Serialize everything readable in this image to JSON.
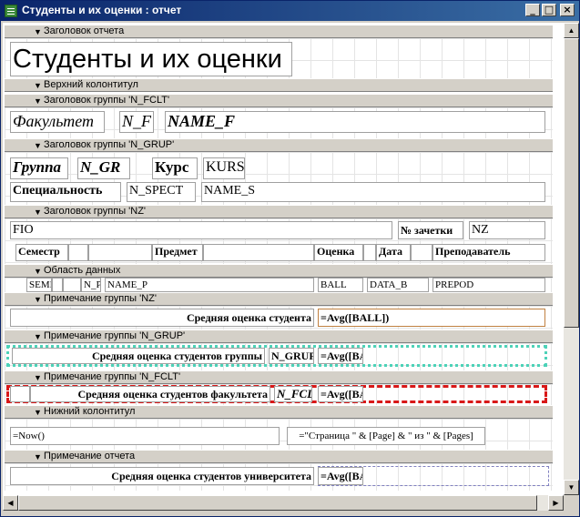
{
  "window": {
    "title": "Студенты и их оценки : отчет",
    "minimize": "_",
    "maximize": "□",
    "close": "×"
  },
  "bars": {
    "report_header": "Заголовок отчета",
    "page_header": "Верхний колонтитул",
    "group_fclt_header": "Заголовок группы 'N_FCLT'",
    "group_grup_header": "Заголовок группы 'N_GRUP'",
    "group_nz_header": "Заголовок группы 'NZ'",
    "detail": "Область данных",
    "group_nz_footer": "Примечание группы 'NZ'",
    "group_grup_footer": "Примечание группы 'N_GRUP'",
    "group_fclt_footer": "Примечание группы 'N_FCLT'",
    "page_footer": "Нижний колонтитул",
    "report_footer": "Примечание отчета"
  },
  "report_header": {
    "title": "Студенты и их оценки"
  },
  "fclt": {
    "label": "Факультет",
    "n_f": "N_F",
    "name_f": "NAME_F"
  },
  "grup": {
    "label": "Группа",
    "n_gr": "N_GR",
    "kurs_label": "Курс",
    "kurs": "KURS",
    "spec_label": "Специальность",
    "n_spect": "N_SPECT",
    "name_s": "NAME_S"
  },
  "nz": {
    "fio": "FIO",
    "zachetka_label": "№ зачетки",
    "nz": "NZ",
    "headers": {
      "semester": "Семестр",
      "subject": "Предмет",
      "grade": "Оценка",
      "date": "Дата",
      "teacher": "Преподаватель"
    }
  },
  "detail": {
    "sem": "SEME",
    "n_p": "N_P",
    "name_p": "NAME_P",
    "ball": "BALL",
    "data_b": "DATA_B",
    "prepod": "PREPOD"
  },
  "nz_footer": {
    "label": "Средняя оценка студента",
    "avg": "=Avg([BALL])"
  },
  "grup_footer": {
    "label": "Средняя оценка студентов группы",
    "n_grup": "N_GRUP",
    "avg": "=Avg([BALL])"
  },
  "fclt_footer": {
    "label": "Средняя оценка студентов  факультета",
    "n_fc": "N_FCLT",
    "avg": "=Avg([BALL])"
  },
  "page_footer": {
    "now": "=Now()",
    "pages": "=\"Страница \" & [Page] & \" из \" & [Pages]"
  },
  "report_footer": {
    "label": "Средняя оценка  студентов университета",
    "avg": "=Avg([BALL])"
  }
}
